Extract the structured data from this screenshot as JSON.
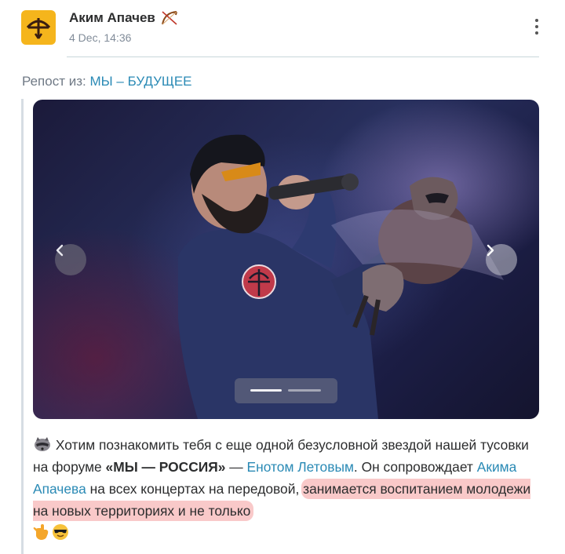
{
  "post": {
    "author": "Аким Апачев",
    "author_emoji": "crossbow-icon",
    "timestamp": "4 Dec, 14:36"
  },
  "repost": {
    "prefix": "Репост из:",
    "source": "МЫ – БУДУЩЕЕ"
  },
  "gallery": {
    "prev_icon": "chevron-left-icon",
    "next_icon": "chevron-right-icon",
    "slides": 2,
    "active_slide": 1
  },
  "text": {
    "t1": " Хотим познакомить тебя с еще одной безусловной звездой нашей тусовки на форуме ",
    "t2": "«МЫ — РОССИЯ»",
    "t3": " — ",
    "link1": "Енотом Летовым",
    "t4": ". Он сопровождает ",
    "link2": "Акима Апачева",
    "t5": " на всех концертах на передовой, ",
    "highlight": "занимается воспитанием молодежи на новых территориях и не только"
  },
  "colors": {
    "link": "#2a8ab5",
    "avatar_bg": "#f5b51c",
    "highlight": "#f07878"
  }
}
